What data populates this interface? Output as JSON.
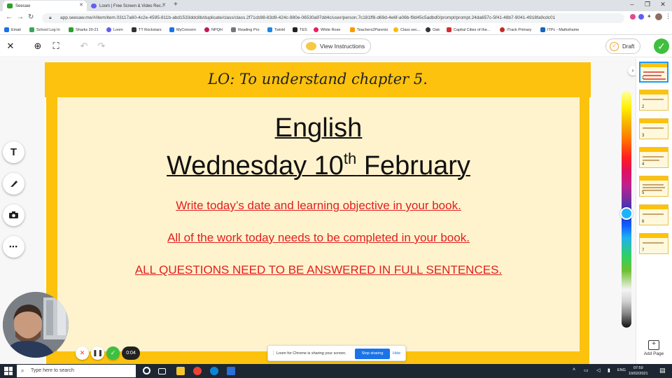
{
  "browser": {
    "tabs": [
      {
        "label": "Seesaw",
        "active": true,
        "color": "#2ca02c"
      },
      {
        "label": "Loom | Free Screen & Video Rec...",
        "active": false,
        "color": "#625df5"
      }
    ],
    "new_tab": "+",
    "url": "app.seesaw.me/#/item/item.03117a60-4c2e-4595-811b-abd1533ddc8b/duplicate/class/class.2f71cb98-83d9-424c-980e-06530a97dd4c/user/person.7c181ff8-d69d-4e6f-a06b-f9d45c5adbd0/prompt/prompt.24da657c-5f41-48b7-9041-4918fa9cdc01",
    "bookmarks": [
      {
        "label": "Email",
        "color": "#1a73e8"
      },
      {
        "label": "School Log In",
        "color": "#34a853"
      },
      {
        "label": "Sharks 20-21",
        "color": "#2ca02c"
      },
      {
        "label": "Loom",
        "color": "#625df5"
      },
      {
        "label": "TT Rockstars",
        "color": "#333333"
      },
      {
        "label": "MyConcern",
        "color": "#1a73e8"
      },
      {
        "label": "NPQH",
        "color": "#c2185b"
      },
      {
        "label": "Reading Pro",
        "color": "#777777"
      },
      {
        "label": "Twinkl",
        "color": "#1e88e5"
      },
      {
        "label": "TES",
        "color": "#222222"
      },
      {
        "label": "White Rose",
        "color": "#e91e63"
      },
      {
        "label": "Teachers2Parents",
        "color": "#ff9800"
      },
      {
        "label": "Class sec...",
        "color": "#fbbc04"
      },
      {
        "label": "Oak",
        "color": "#333333"
      },
      {
        "label": "Capital Cities of the...",
        "color": "#d32f2f"
      },
      {
        "label": "iTrack Primary",
        "color": "#c62828"
      },
      {
        "label": "ITPc - Mathsframe",
        "color": "#1565c0"
      }
    ]
  },
  "toolbar": {
    "view_instructions": "View Instructions",
    "draft": "Draft"
  },
  "slide": {
    "lo": "LO: To understand chapter 5.",
    "title": "English",
    "date_prefix": "Wednesday 10",
    "date_sup": "th",
    "date_suffix": " February",
    "lines": [
      "Write today’s date and learning objective in your book.",
      "All of the work today needs to be completed in your book.",
      "ALL QUESTIONS NEED TO BE ANSWERED IN FULL SENTENCES."
    ]
  },
  "tools": {
    "text": "T",
    "more": "•••"
  },
  "loom": {
    "timer": "0:04",
    "share_text": "Loom for Chrome is sharing your screen.",
    "stop_sharing": "Stop sharing",
    "hide": "Hide"
  },
  "pages": {
    "numbers": [
      "1",
      "2",
      "3",
      "4",
      "5",
      "6",
      "7"
    ],
    "add_page": "Add Page"
  },
  "taskbar": {
    "search_placeholder": "Type here to search",
    "lang": "ENG",
    "time": "07:59",
    "date": "10/02/2021"
  },
  "colors": {
    "accent_yellow": "#fcc20d",
    "panel_bg": "#fff3cd",
    "red_text": "#e02020",
    "done_green": "#3fbf3f",
    "selected_blue": "#1a9bff"
  }
}
